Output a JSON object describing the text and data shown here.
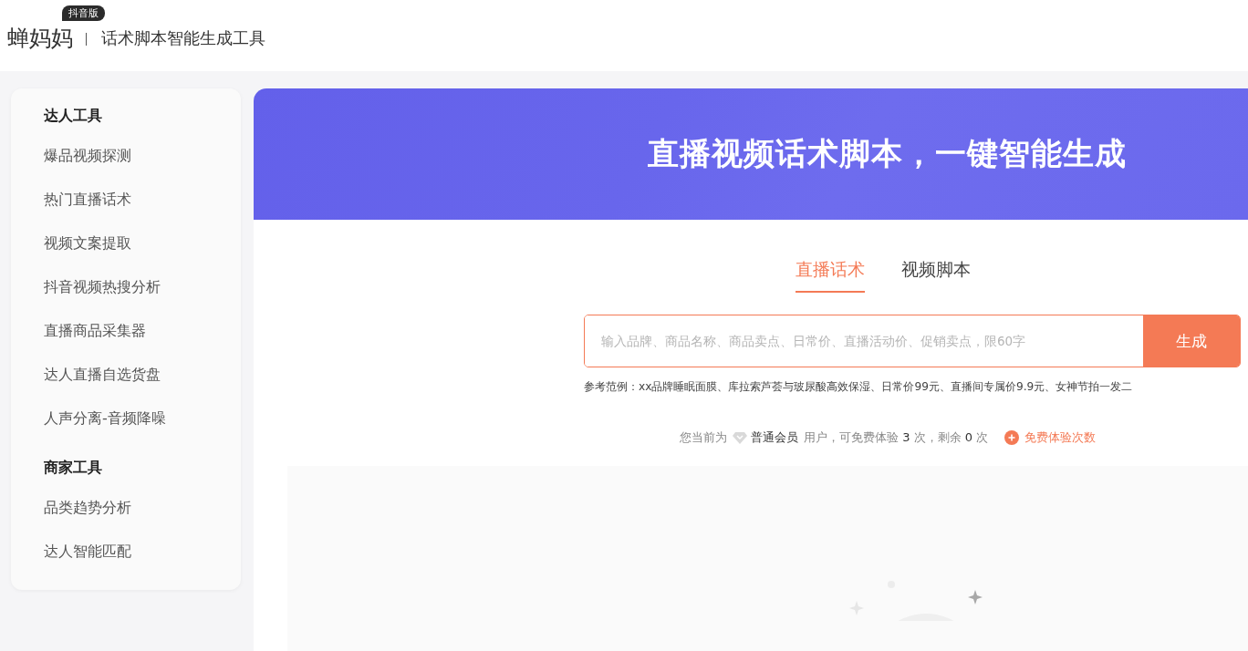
{
  "header": {
    "logo": "蝉妈妈",
    "badge": "抖音版",
    "title": "话术脚本智能生成工具"
  },
  "sidebar": {
    "groups": [
      {
        "heading": "达人工具",
        "items": [
          "爆品视频探测",
          "热门直播话术",
          "视频文案提取",
          "抖音视频热搜分析",
          "直播商品采集器",
          "达人直播自选货盘",
          "人声分离-音频降噪"
        ]
      },
      {
        "heading": "商家工具",
        "items": [
          "品类趋势分析",
          "达人智能匹配"
        ]
      }
    ]
  },
  "banner": {
    "headline": "直播视频话术脚本，一键智能生成"
  },
  "tabs": [
    {
      "label": "直播话术",
      "selected": true
    },
    {
      "label": "视频脚本",
      "selected": false
    }
  ],
  "search": {
    "placeholder": "输入品牌、商品名称、商品卖点、日常价、直播活动价、促销卖点，限60字",
    "button": "生成"
  },
  "example": "参考范例：xx品牌睡眠面膜、库拉索芦荟与玻尿酸高效保湿、日常价99元、直播间专属价9.9元、女神节拍一发二",
  "quota": {
    "prefix": "您当前为",
    "level": "普通会员",
    "text": "用户，可免费体验 **3** 次，剩余 **0** 次",
    "link": "免费体验次数"
  }
}
